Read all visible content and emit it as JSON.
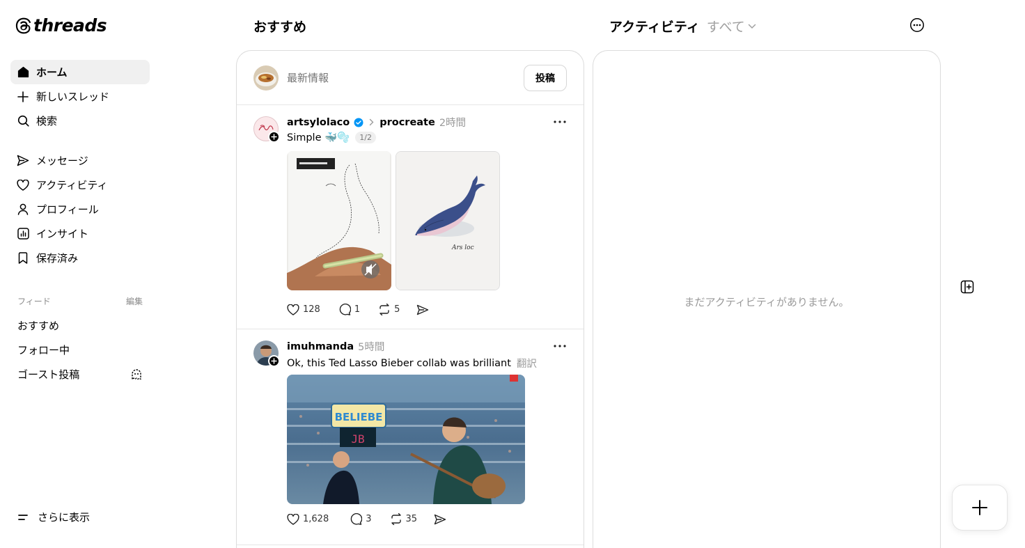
{
  "app": {
    "logo_text": "threads"
  },
  "sidebar": {
    "nav": [
      {
        "label": "ホーム",
        "icon": "home-icon",
        "active": true
      },
      {
        "label": "新しいスレッド",
        "icon": "plus-icon"
      },
      {
        "label": "検索",
        "icon": "search-icon"
      },
      {
        "label": "メッセージ",
        "icon": "send-icon"
      },
      {
        "label": "アクティビティ",
        "icon": "heart-icon"
      },
      {
        "label": "プロフィール",
        "icon": "person-icon"
      },
      {
        "label": "インサイト",
        "icon": "insights-icon"
      },
      {
        "label": "保存済み",
        "icon": "bookmark-icon"
      }
    ],
    "feeds_heading": "フィード",
    "feeds_edit": "編集",
    "feeds": [
      {
        "label": "おすすめ"
      },
      {
        "label": "フォロー中"
      },
      {
        "label": "ゴースト投稿",
        "icon": "ghost-icon"
      }
    ],
    "more_label": "さらに表示"
  },
  "feed_column": {
    "title": "おすすめ",
    "composer": {
      "placeholder": "最新情報",
      "post_button": "投稿"
    },
    "posts": [
      {
        "username": "artsylolaco",
        "verified": true,
        "community": "procreate",
        "time": "2時間",
        "text": "Simple 🐳🫧",
        "page_indicator": "1/2",
        "media": [
          "drawing-video-thumbnail",
          "whale-illustration-image"
        ],
        "likes": "128",
        "replies": "1",
        "reposts": "5"
      },
      {
        "username": "imuhmanda",
        "time": "5時間",
        "text": "Ok, this Ted Lasso Bieber collab was brilliant",
        "translate_label": "翻訳",
        "media_sign_text": "BELIEBE",
        "media_sign_sub": "JB",
        "likes": "1,628",
        "replies": "3",
        "reposts": "35"
      }
    ]
  },
  "activity_column": {
    "title": "アクティビティ",
    "filter": "すべて",
    "empty_message": "まだアクティビティがありません。"
  },
  "colors": {
    "accent_verified": "#0095f6",
    "text_secondary": "#9a9a9a",
    "border": "#dcdcdc"
  }
}
